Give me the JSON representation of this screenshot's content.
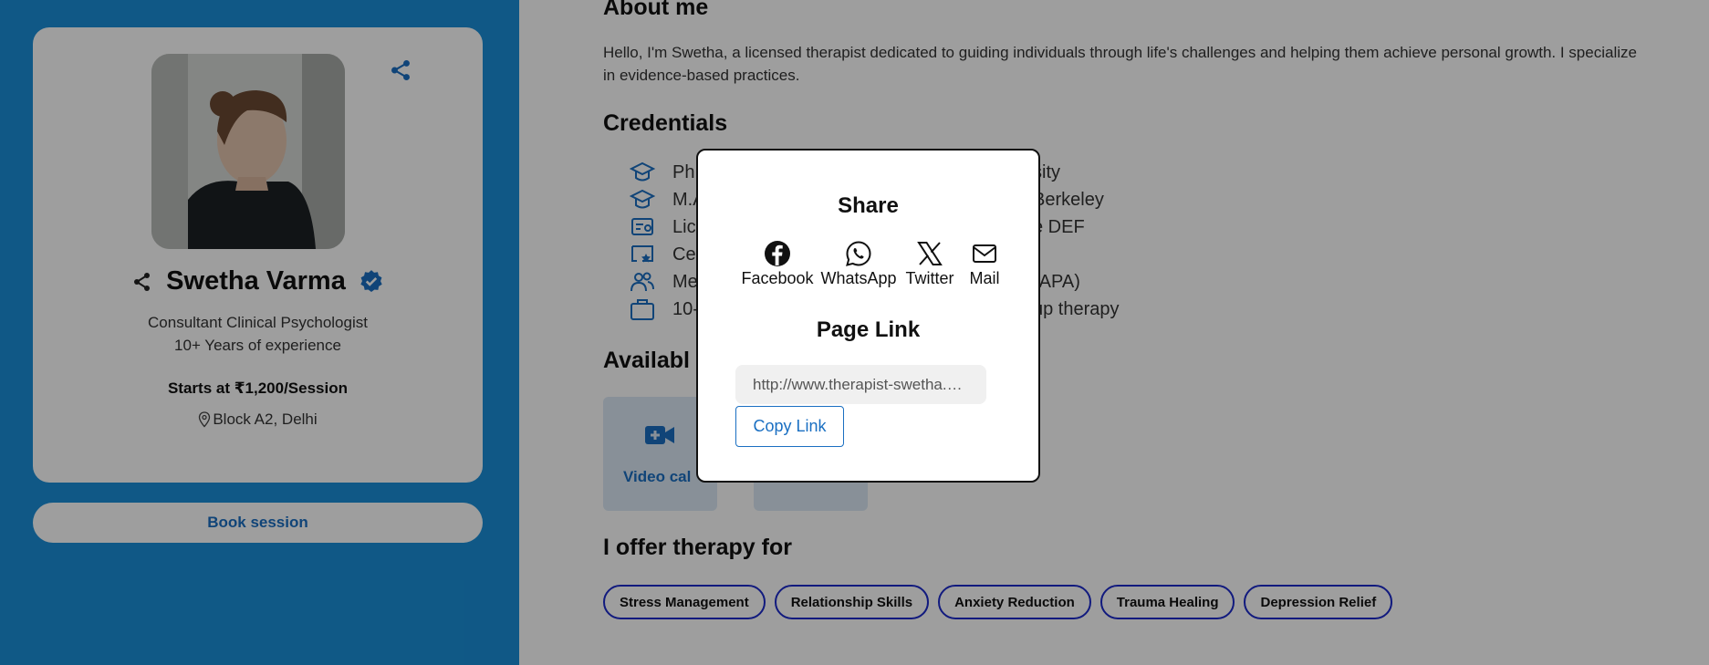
{
  "profile": {
    "name": "Swetha Varma",
    "title": "Consultant Clinical Psychologist",
    "experience": "10+ Years of experience",
    "price": "Starts at ₹1,200/Session",
    "location": "Block A2, Delhi",
    "book_label": "Book session",
    "colors": {
      "panel": "#1a8fd8",
      "accent": "#1a6fc2"
    }
  },
  "about": {
    "heading": "About me",
    "text": "Hello, I'm Swetha, a licensed therapist dedicated to guiding individuals through life's challenges and helping them achieve personal growth. I specialize in evidence-based practices."
  },
  "credentials": {
    "heading": "Credentials",
    "items": [
      {
        "icon": "graduation-cap-icon",
        "text_left": "Ph",
        "text_right": "sity"
      },
      {
        "icon": "graduation-cap-icon",
        "text_left": "M.A",
        "text_right": "Berkeley"
      },
      {
        "icon": "license-icon",
        "text_left": "Lic",
        "text_right": "e DEF"
      },
      {
        "icon": "certificate-icon",
        "text_left": "Ce",
        "text_right": ")"
      },
      {
        "icon": "members-icon",
        "text_left": "Me",
        "text_right": "(APA)"
      },
      {
        "icon": "briefcase-icon",
        "text_left": "10-",
        "text_right": "up therapy"
      }
    ]
  },
  "availability": {
    "heading": "Availabl",
    "options": [
      {
        "label": "Video cal",
        "icon": "video-camera-icon"
      },
      {
        "label": "",
        "icon": ""
      }
    ]
  },
  "therapy": {
    "heading": "I offer therapy for",
    "tags": [
      "Stress Management",
      "Relationship Skills",
      "Anxiety Reduction",
      "Trauma Healing",
      "Depression Relief"
    ]
  },
  "share_modal": {
    "title": "Share",
    "options": [
      {
        "label": "Facebook",
        "icon": "facebook-icon"
      },
      {
        "label": "WhatsApp",
        "icon": "whatsapp-icon"
      },
      {
        "label": "Twitter",
        "icon": "twitter-x-icon"
      },
      {
        "label": "Mail",
        "icon": "mail-icon"
      }
    ],
    "link_title": "Page Link",
    "link_value": "http://www.therapist-swetha.com",
    "copy_label": "Copy Link"
  }
}
